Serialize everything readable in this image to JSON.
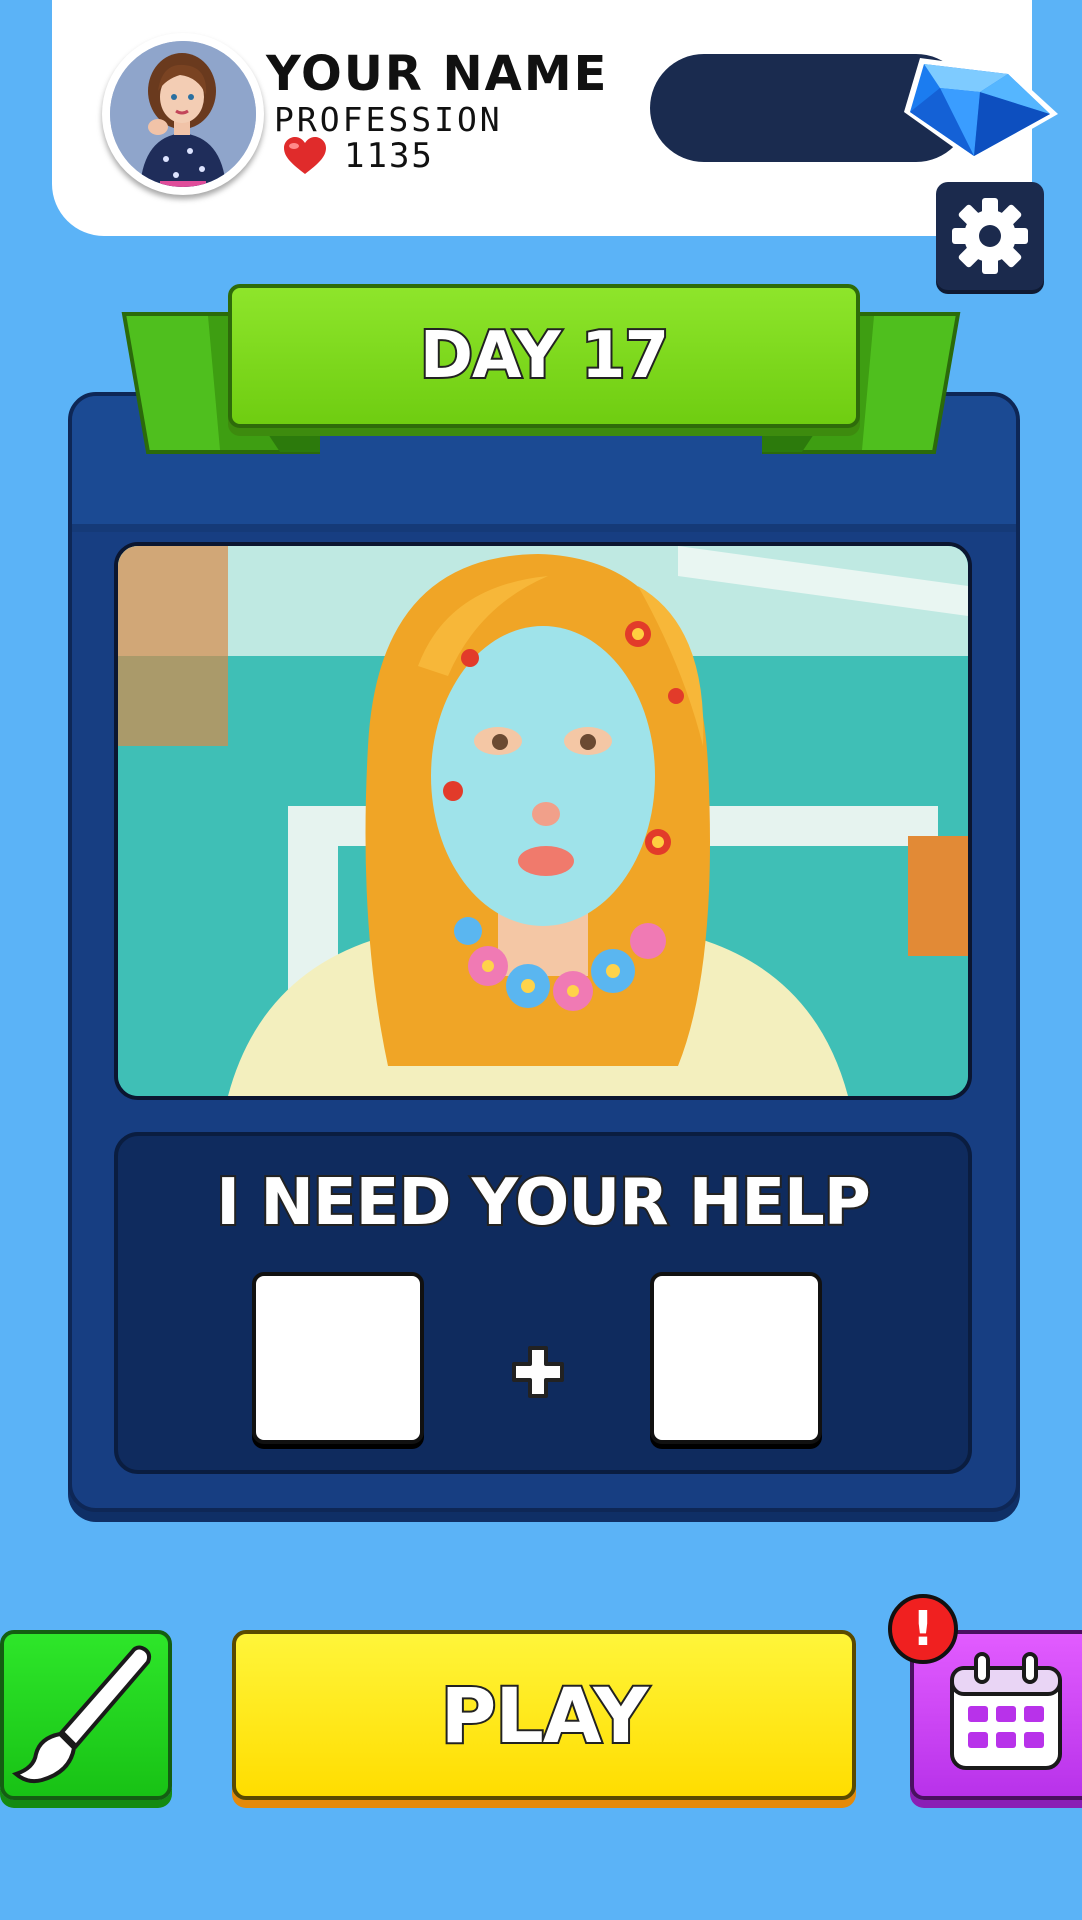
{
  "header": {
    "player_name": "YOUR NAME",
    "profession": "PROFESSION",
    "likes": "1135",
    "icons": {
      "avatar": "player-avatar",
      "likes": "heart-icon",
      "currency": "diamond-gem-icon"
    }
  },
  "settings": {
    "icon": "gear-icon"
  },
  "level": {
    "day_label": "DAY 17"
  },
  "request": {
    "title": "I NEED YOUR HELP",
    "operator": "+",
    "slots": [
      "empty",
      "empty"
    ]
  },
  "actions": {
    "play_label": "PLAY",
    "left_icon": "paintbrush-icon",
    "right_icon": "calendar-icon",
    "alert": "!"
  },
  "colors": {
    "background": "#5bb3f7",
    "panel": "#173e82",
    "ribbon": "#7ed321",
    "play": "#ffe81a",
    "paint": "#22d41f",
    "calendar": "#cc44f5",
    "gem_bar": "#1a2b4f",
    "heart": "#e02b2b"
  }
}
